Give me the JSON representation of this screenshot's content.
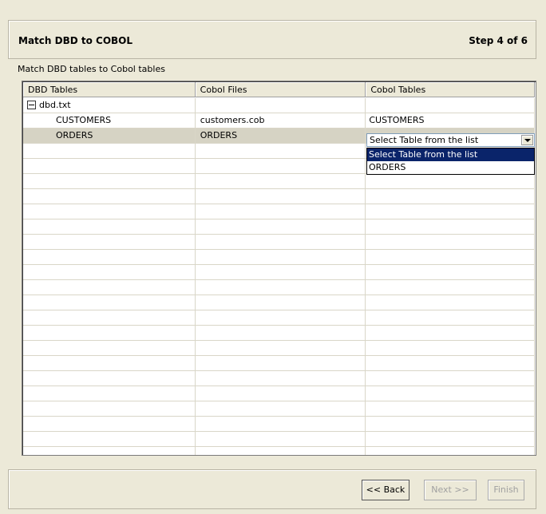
{
  "header": {
    "title": "Match DBD to COBOL",
    "step": "Step 4 of 6"
  },
  "subtitle": "Match DBD tables to Cobol tables",
  "table": {
    "columns": [
      "DBD Tables",
      "Cobol Files",
      "Cobol Tables"
    ],
    "rows": [
      {
        "dbd": "dbd.txt",
        "file": "",
        "table": ""
      },
      {
        "dbd": "CUSTOMERS",
        "file": "customers.cob",
        "table": "CUSTOMERS"
      },
      {
        "dbd": "ORDERS",
        "file": "ORDERS",
        "table": ""
      }
    ]
  },
  "combo": {
    "value": "Select Table from the list",
    "options": [
      "Select Table from the list",
      "ORDERS"
    ]
  },
  "footer": {
    "back": "<< Back",
    "next": "Next >>",
    "finish": "Finish"
  },
  "colors": {
    "selection": "#0a246a",
    "panel": "#ece9d8"
  }
}
